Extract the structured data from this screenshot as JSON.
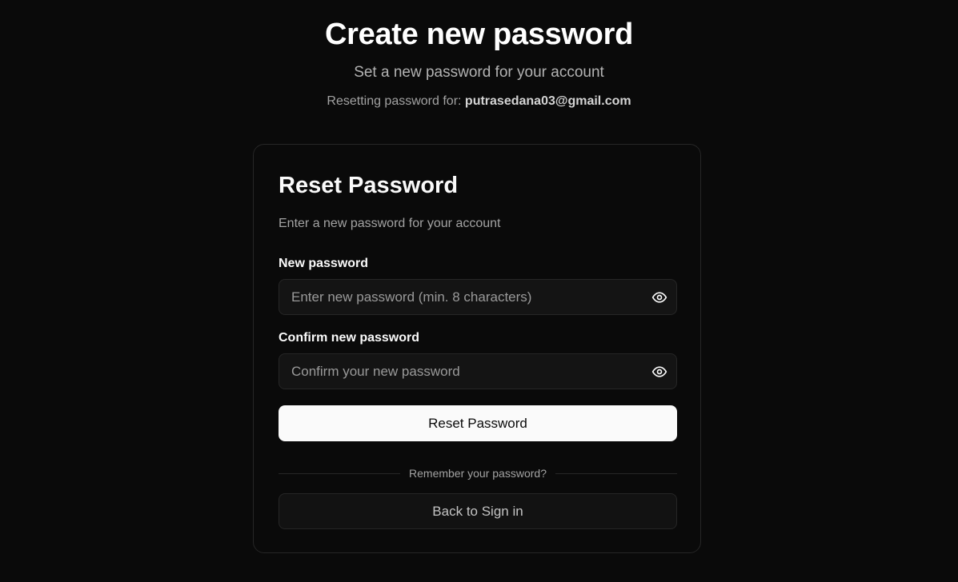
{
  "header": {
    "title": "Create new password",
    "subtitle": "Set a new password for your account",
    "resetting_prefix": "Resetting password for:",
    "email": "putrasedana03@gmail.com"
  },
  "card": {
    "title": "Reset Password",
    "description": "Enter a new password for your account",
    "new_password": {
      "label": "New password",
      "placeholder": "Enter new password (min. 8 characters)",
      "value": "",
      "toggle_icon": "eye-icon"
    },
    "confirm_password": {
      "label": "Confirm new password",
      "placeholder": "Confirm your new password",
      "value": "",
      "toggle_icon": "eye-icon"
    },
    "submit_label": "Reset Password",
    "divider_text": "Remember your password?",
    "back_label": "Back to Sign in"
  },
  "colors": {
    "background": "#0a0a0a",
    "card_border": "#262626",
    "primary_button_bg": "#fafafa",
    "primary_button_text": "#0a0a0a",
    "muted_text": "#a3a3a3"
  }
}
